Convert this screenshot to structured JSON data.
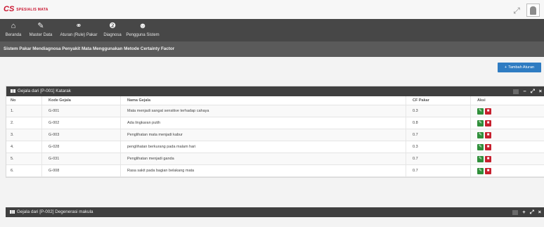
{
  "app": {
    "logo_text": "SPESIALIS MATA"
  },
  "nav": {
    "items": [
      {
        "label": "Beranda",
        "icon": "home-icon"
      },
      {
        "label": "Master Data",
        "icon": "edit-icon"
      },
      {
        "label": "Aturan (Rule) Pakar",
        "icon": "bulb-icon"
      },
      {
        "label": "Diagnosa",
        "icon": "info-icon"
      },
      {
        "label": "Pengguna Sistem",
        "icon": "users-icon"
      }
    ]
  },
  "subtitle": "Sistem Pakar Mendiagnosa Penyakit Mata Menggunakan Metode Certainty Factor",
  "actions": {
    "add_label": "Tambah Aturan"
  },
  "panels": [
    {
      "title": "Gejala dari [P-001] Katarak"
    },
    {
      "title": "Gejala dari [P-002] Degenerasi makula"
    }
  ],
  "table": {
    "headers": {
      "no": "No",
      "kode": "Kode Gejala",
      "nama": "Nama Gejala",
      "cf": "CF Pakar",
      "aksi": "Aksi"
    },
    "rows": [
      {
        "no": "1.",
        "kode": "G-001",
        "nama": "Mata menjadi sangat sensitive terhadap cahaya",
        "cf": "0.3"
      },
      {
        "no": "2.",
        "kode": "G-002",
        "nama": "Ada lingkaran putih",
        "cf": "0.8"
      },
      {
        "no": "3.",
        "kode": "G-003",
        "nama": "Penglihatan mata menjadi kabur",
        "cf": "0.7"
      },
      {
        "no": "4.",
        "kode": "G-028",
        "nama": "penglihatan berkurang pada malam hari",
        "cf": "0.3"
      },
      {
        "no": "5.",
        "kode": "G-031",
        "nama": "Penglihatan menjadi ganda",
        "cf": "0.7"
      },
      {
        "no": "6.",
        "kode": "G-008",
        "nama": "Rasa sakit pada bagian belakang mata",
        "cf": "0.7"
      }
    ]
  },
  "colors": {
    "navbar": "#474747",
    "primary": "#2f7cc2",
    "edit": "#2f8f3a",
    "delete": "#c6202e",
    "brand": "#c9122d"
  }
}
